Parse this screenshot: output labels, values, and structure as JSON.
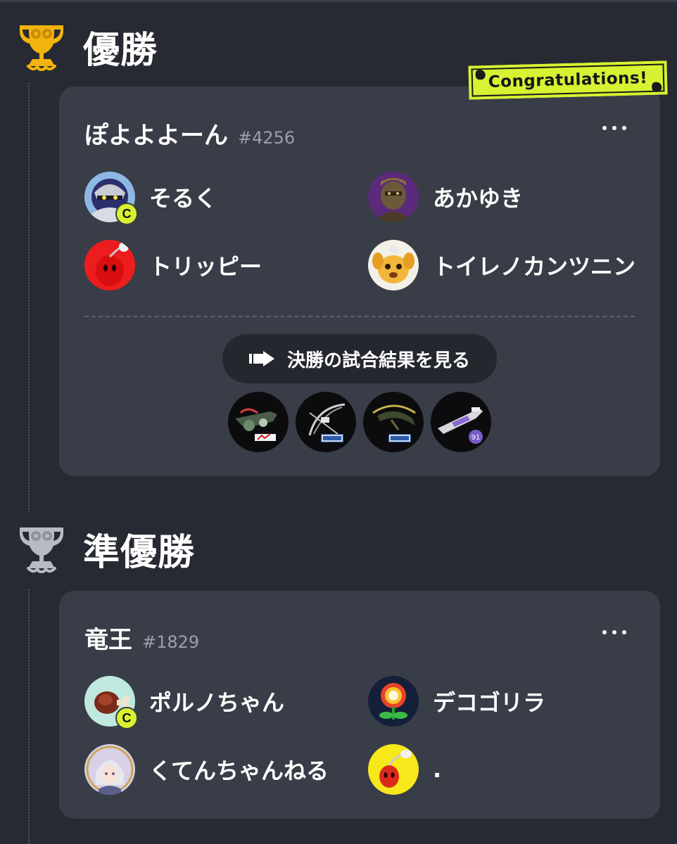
{
  "colors": {
    "background": "#272a32",
    "card": "#393d47",
    "accent": "#d6f232",
    "gold": "#f2b30e",
    "silver": "#b7bcc4"
  },
  "winner": {
    "section_title": "優勝",
    "trophy_icon": "gold-trophy-icon",
    "banner": "Congratulations!",
    "team": {
      "name": "ぽよよよーん",
      "id": "#4256",
      "members": [
        {
          "name": "そるく",
          "captain": true,
          "captain_badge": "C",
          "avatar": "knight-avatar"
        },
        {
          "name": "あかゆき",
          "captain": false,
          "avatar": "warrior-avatar"
        },
        {
          "name": "トリッピー",
          "captain": false,
          "avatar": "red-creature-avatar"
        },
        {
          "name": "トイレノカンツニン",
          "captain": false,
          "avatar": "yellow-dog-avatar"
        }
      ]
    },
    "results_button": "決勝の試合結果を見る",
    "weapons": [
      {
        "icon": "weapon-1-icon"
      },
      {
        "icon": "weapon-2-icon"
      },
      {
        "icon": "weapon-3-icon"
      },
      {
        "icon": "weapon-4-icon",
        "badge": "91"
      }
    ]
  },
  "runner_up": {
    "section_title": "準優勝",
    "trophy_icon": "silver-trophy-icon",
    "team": {
      "name": "竜王",
      "id": "#1829",
      "members": [
        {
          "name": "ポルノちゃん",
          "captain": true,
          "captain_badge": "C",
          "avatar": "meat-avatar"
        },
        {
          "name": "デコゴリラ",
          "captain": false,
          "avatar": "fire-flower-avatar"
        },
        {
          "name": "くてんちゃんねる",
          "captain": false,
          "avatar": "anime-girl-avatar"
        },
        {
          "name": ".",
          "captain": false,
          "avatar": "yellow-creature-avatar"
        }
      ]
    }
  }
}
